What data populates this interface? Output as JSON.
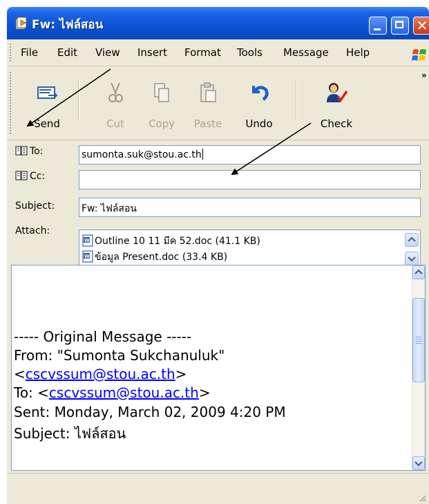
{
  "window": {
    "title": "Fw: ไฟล์สอน"
  },
  "menu": [
    "File",
    "Edit",
    "View",
    "Insert",
    "Format",
    "Tools",
    "Message",
    "Help"
  ],
  "toolbar": {
    "send": "Send",
    "cut": "Cut",
    "copy": "Copy",
    "paste": "Paste",
    "undo": "Undo",
    "check": "Check",
    "more": "»"
  },
  "headers": {
    "to_label": "To:",
    "to_value": "sumonta.suk@stou.ac.th",
    "cc_label": "Cc:",
    "cc_value": "",
    "subject_label": "Subject:",
    "subject_value": "Fw: ไฟล์สอน",
    "attach_label": "Attach:",
    "attachments": [
      "Outline 10 11 มีค 52.doc (41.1 KB)",
      "ข้อมูล Present.doc (33.4 KB)"
    ]
  },
  "message": {
    "separator": "----- Original Message -----",
    "from_prefix": "From: \"Sumonta Sukchanuluk\"",
    "from_open": "<",
    "from_email": "cscvssum@stou.ac.th",
    "from_close": ">",
    "to_prefix": "To: <",
    "to_email": "cscvssum@stou.ac.th",
    "to_close": ">",
    "sent": "Sent: Monday, March 02, 2009 4:20 PM",
    "subject": "Subject: ไฟล์สอน"
  },
  "colors": {
    "xp_blue": "#0b52d4",
    "close_red": "#c7391a",
    "link": "#0000ff"
  }
}
